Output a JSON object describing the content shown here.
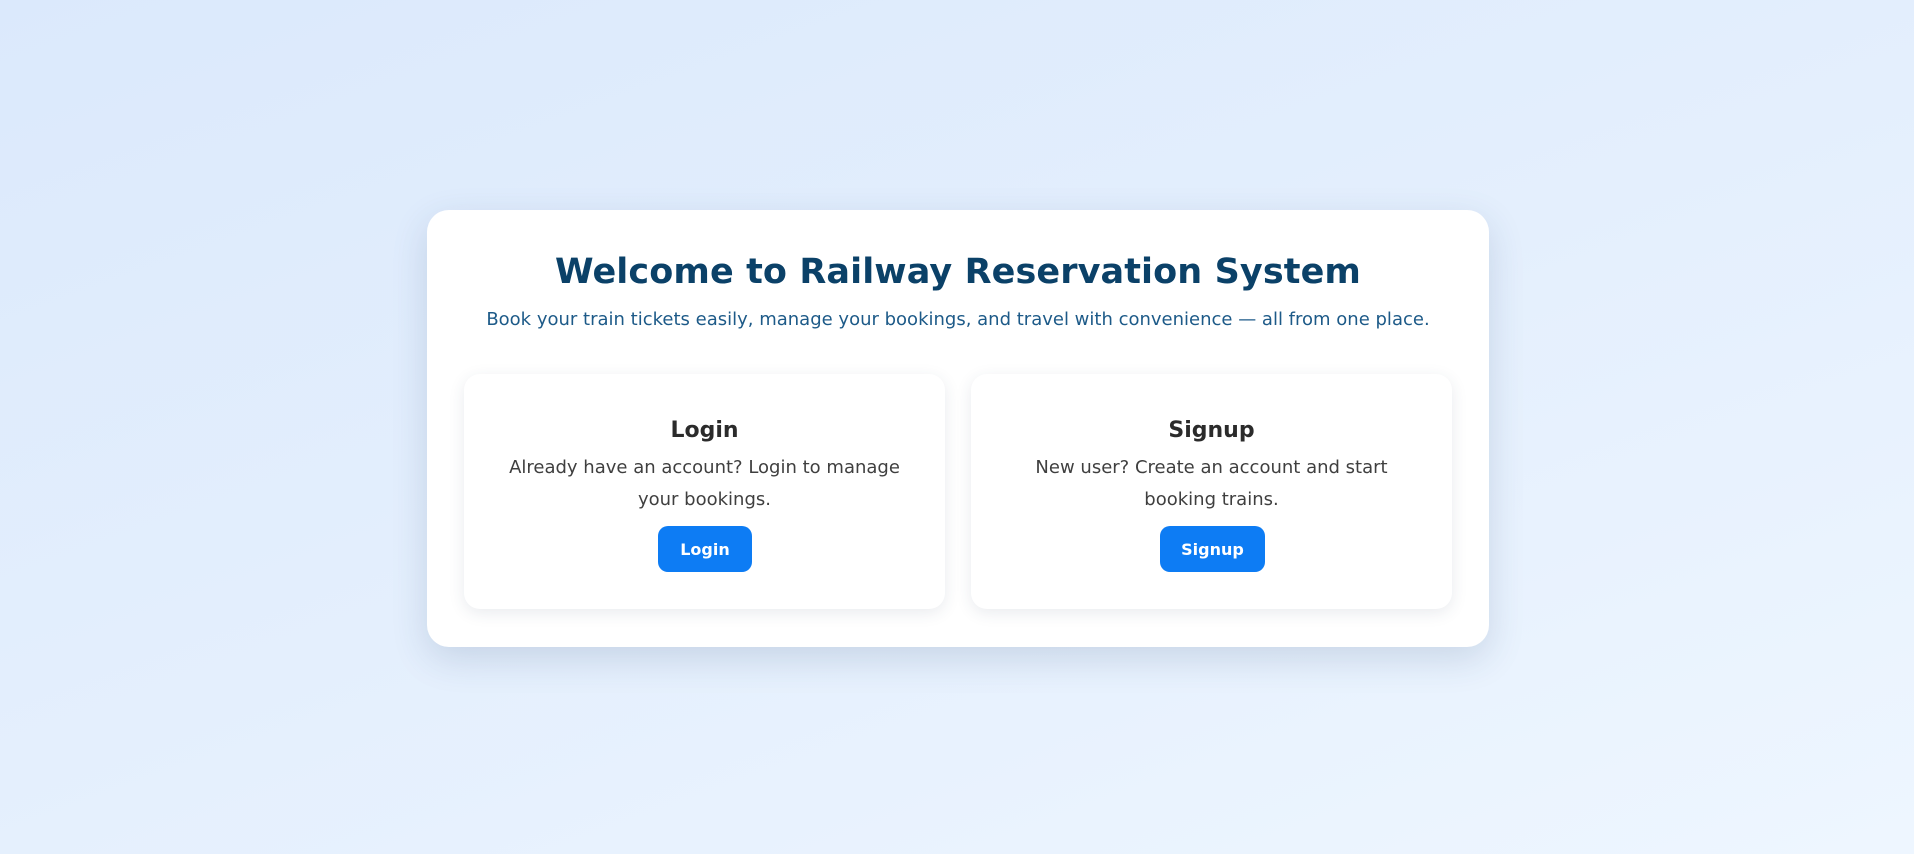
{
  "header": {
    "title": "Welcome to Railway Reservation System",
    "subtitle": "Book your train tickets easily, manage your bookings, and travel with convenience — all from one place."
  },
  "cards": {
    "login": {
      "title": "Login",
      "description": "Already have an account? Login to manage your bookings.",
      "button_label": "Login"
    },
    "signup": {
      "title": "Signup",
      "description": "New user? Create an account and start booking trains.",
      "button_label": "Signup"
    }
  },
  "colors": {
    "title": "#0b4168",
    "subtitle": "#1d5a88",
    "button": "#0d7cf4",
    "background": "#dbe9fc"
  }
}
